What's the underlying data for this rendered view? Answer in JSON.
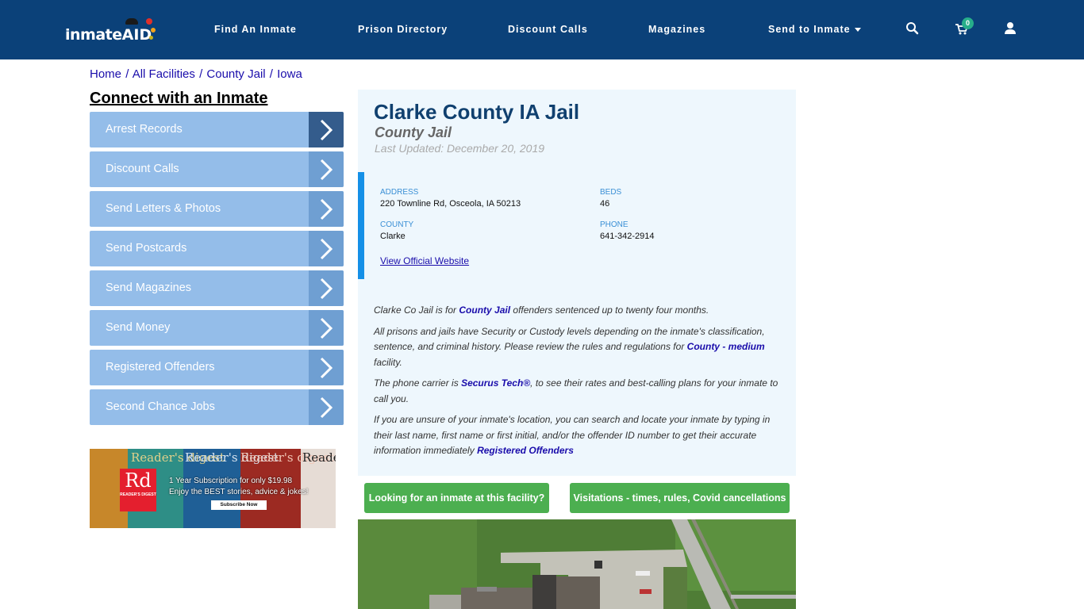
{
  "header": {
    "logo_text": "inmate",
    "logo_accent": "AID",
    "nav": [
      {
        "label": "Find An Inmate"
      },
      {
        "label": "Prison Directory"
      },
      {
        "label": "Discount Calls"
      },
      {
        "label": "Magazines"
      },
      {
        "label": "Send to Inmate",
        "has_dropdown": true
      }
    ],
    "cart_count": "0",
    "icons": [
      "search-icon",
      "cart-icon",
      "user-icon"
    ]
  },
  "breadcrumb": [
    {
      "label": "Home"
    },
    {
      "label": "All Facilities"
    },
    {
      "label": "County Jail"
    },
    {
      "label": "Iowa"
    }
  ],
  "breadcrumb_separator": "/",
  "sidebar": {
    "title": "Connect with an Inmate",
    "items": [
      {
        "label": "Arrest Records"
      },
      {
        "label": "Discount Calls"
      },
      {
        "label": "Send Letters & Photos"
      },
      {
        "label": "Send Postcards"
      },
      {
        "label": "Send Magazines"
      },
      {
        "label": "Send Money"
      },
      {
        "label": "Registered Offenders"
      },
      {
        "label": "Second Chance Jobs"
      }
    ],
    "ad": {
      "brand": "Rd",
      "brand_sub": "READER'S DIGEST",
      "magazine_title": "Reader's digest",
      "line1": "1 Year Subscription for only $19.98",
      "line2": "Enjoy the BEST stories, advice & jokes!",
      "button": "Subscribe Now"
    }
  },
  "facility": {
    "name": "Clarke County IA Jail",
    "type": "County Jail",
    "last_updated": "Last Updated: December 20, 2019",
    "address_label": "ADDRESS",
    "address": "220 Townline Rd, Osceola, IA 50213",
    "beds_label": "BEDS",
    "beds": "46",
    "county_label": "COUNTY",
    "county": "Clarke",
    "phone_label": "PHONE",
    "phone": "641-342-2914",
    "website_link": "View Official Website"
  },
  "description": {
    "p1_pre": "Clarke Co Jail is for ",
    "p1_link": "County Jail",
    "p1_post": " offenders sentenced up to twenty four months.",
    "p2_pre": "All prisons and jails have Security or Custody levels depending on the inmate's classification, sentence, and criminal history. Please review the rules and regulations for ",
    "p2_link": "County - medium",
    "p2_post": " facility.",
    "p3_pre": "The phone carrier is ",
    "p3_link": "Securus Tech®",
    "p3_post": ", to see their rates and best-calling plans for your inmate to call you.",
    "p4_pre": "If you are unsure of your inmate's location, you can search and locate your inmate by typing in their last name, first name or first initial, and/or the offender ID number to get their accurate information immediately ",
    "p4_link": "Registered Offenders"
  },
  "buttons": {
    "find_inmate": "Looking for an inmate at this facility?",
    "visitations": "Visitations - times, rules, Covid cancellations"
  },
  "colors": {
    "header_bg": "#0b4179",
    "menu_bg": "#94bde9",
    "menu_arrow": "#6f9fd2",
    "menu_arrow_active": "#345c8c",
    "card_bg": "#eef7fd",
    "accent_bar": "#1590e7",
    "green_button": "#4caf50",
    "title": "#10406f"
  }
}
